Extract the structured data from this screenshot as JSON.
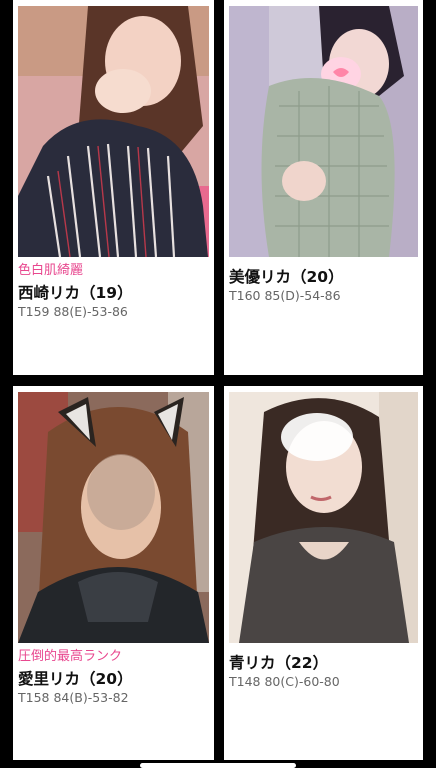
{
  "cards": [
    {
      "tagline": "色白肌綺麗",
      "name": "西崎リカ（19）",
      "stats": "T159 88(E)-53-86",
      "photo": "profile-photo-1"
    },
    {
      "tagline": "",
      "name": "美優リカ（20）",
      "stats": "T160 85(D)-54-86",
      "photo": "profile-photo-2"
    },
    {
      "tagline": "圧倒的最高ランク",
      "name": "愛里リカ（20）",
      "stats": "T158 84(B)-53-82",
      "photo": "profile-photo-3"
    },
    {
      "tagline": "",
      "name": "青リカ（22）",
      "stats": "T148 80(C)-60-80",
      "photo": "profile-photo-4"
    }
  ],
  "colors": {
    "tagline": "#e8488f",
    "background": "#000000",
    "card": "#ffffff"
  }
}
